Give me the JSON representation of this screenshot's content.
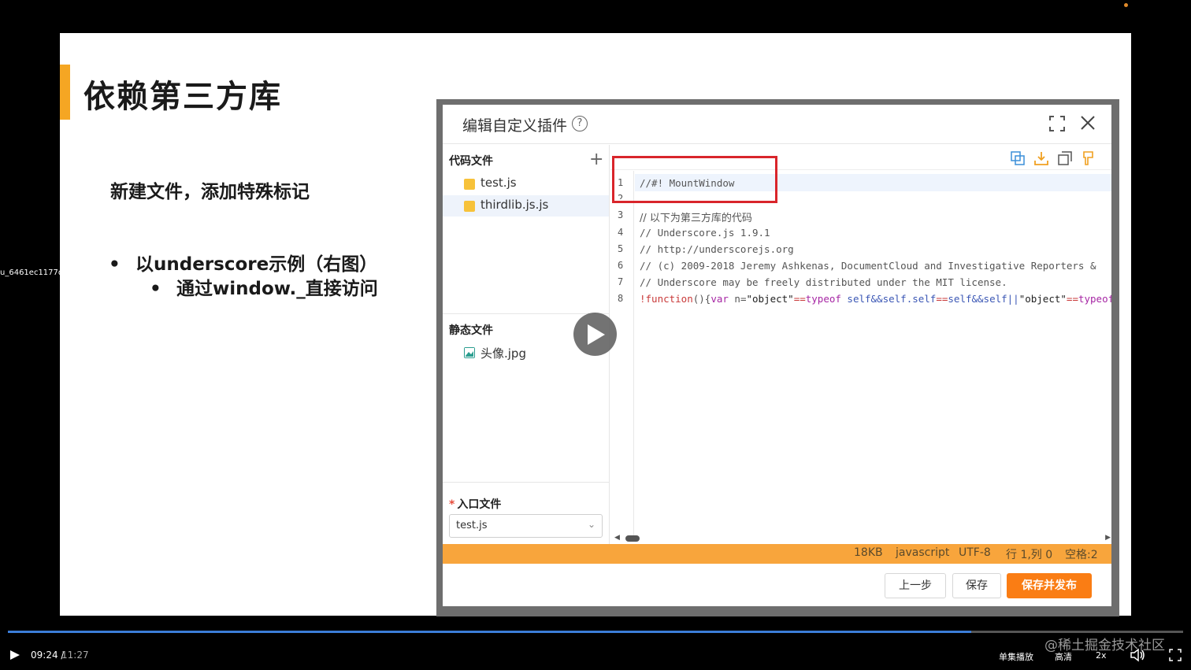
{
  "slide": {
    "title": "依赖第三方库",
    "subtitle": "新建文件，添加特殊标记",
    "bullets": [
      "以underscore示例（右图）",
      "通过window._直接访问"
    ],
    "bullet_symbol": "•"
  },
  "side_label": "u_6461ec1177d",
  "dialog": {
    "title": "编辑自定义插件",
    "help_symbol": "?",
    "code_files_label": "代码文件",
    "add_symbol": "+",
    "code_files": [
      "test.js",
      "thirdlib.js.js"
    ],
    "static_files_label": "静态文件",
    "static_files": [
      "头像.jpg"
    ],
    "entry_label": "入口文件",
    "entry_required": "*",
    "entry_value": "test.js",
    "chevron": "⌄",
    "line_numbers": [
      "1",
      "2",
      "3",
      "4",
      "5",
      "6",
      "7",
      "8"
    ],
    "code_lines": [
      "//#! MountWindow",
      "",
      "// 以下为第三方库的代码",
      "//     Underscore.js 1.9.1",
      "//     http://underscorejs.org",
      "//     (c) 2009-2018 Jeremy Ashkenas, DocumentCloud and Investigative Reporters &",
      "//     Underscore may be freely distributed under the MIT license."
    ],
    "code_line_8": {
      "p1": "!function",
      "p2": "(){",
      "p3": "var",
      "p4": " n=",
      "p5": "\"object\"",
      "p6": "==",
      "p7": "typeof",
      "p8": " self&&self.self",
      "p9": "==",
      "p10": "self&&self||",
      "p11": "\"object\"",
      "p12": "==",
      "p13": "typeof"
    },
    "scroll_left": "◀",
    "scroll_right": "▶",
    "status": {
      "size": "18KB",
      "language": "javascript",
      "encoding": "UTF-8",
      "position": "行 1,列 0",
      "indent": "空格:2"
    },
    "buttons": {
      "prev": "上一步",
      "save": "保存",
      "publish": "保存并发布"
    },
    "accent_color": "#fa7d14"
  },
  "player": {
    "time_current": "09:24",
    "time_sep": " /",
    "time_total": "11:27",
    "progress": 0.82,
    "single_loop": "单集播放",
    "quality": "高清",
    "speed": "2x",
    "watermark": "@稀土掘金技术社区"
  }
}
